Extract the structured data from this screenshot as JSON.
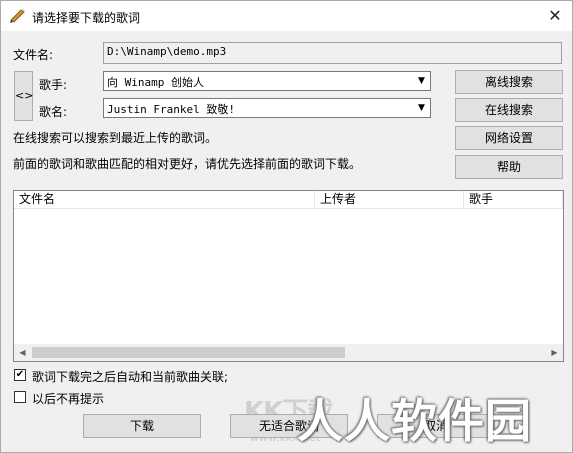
{
  "window": {
    "title": "请选择要下载的歌词",
    "close": "✕"
  },
  "file": {
    "label": "文件名:",
    "value": "D:\\Winamp\\demo.mp3"
  },
  "toggle": "<>",
  "singer": {
    "label": "歌手:",
    "value": "向 Winamp 创始人"
  },
  "song": {
    "label": "歌名:",
    "value": "Justin Frankel 致敬!"
  },
  "buttons": {
    "offline": "离线搜索",
    "online": "在线搜索",
    "network": "网络设置",
    "help": "帮助",
    "download": "下载",
    "no_match": "无适合歌词",
    "cancel": "取消"
  },
  "info": {
    "line1": "在线搜索可以搜索到最近上传的歌词。",
    "line2": "前面的歌词和歌曲匹配的相对更好，请优先选择前面的歌词下载。"
  },
  "table": {
    "columns": [
      "文件名",
      "上传者",
      "歌手"
    ],
    "rows": []
  },
  "options": {
    "auto_link": {
      "label": "歌词下载完之后自动和当前歌曲关联;",
      "checked": true
    },
    "no_prompt": {
      "label": "以后不再提示",
      "checked": false
    }
  },
  "watermarks": {
    "kkx_title": "KK下载",
    "kkx_url": "www.kkx.net",
    "rrrj": "人人软件园"
  }
}
